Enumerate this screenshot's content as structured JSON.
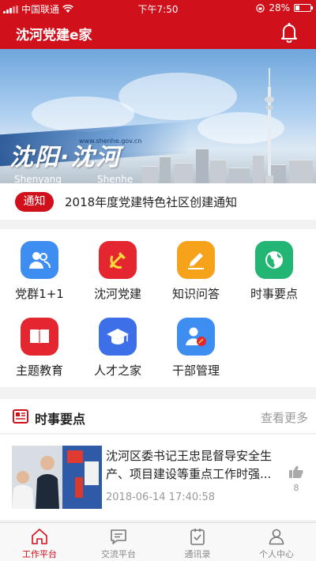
{
  "status_bar": {
    "carrier": "中国联通",
    "time": "下午7:50",
    "battery": "28%",
    "battery_level": 0.28
  },
  "header": {
    "title": "沈河党建e家"
  },
  "banner": {
    "big_text": "沈阳·沈河",
    "sub_left": "Shenyang",
    "sub_right": "Shenhe",
    "url": "www.shenhe.gov.cn",
    "page_count": 2,
    "active_page": 1
  },
  "notice": {
    "tag": "通知",
    "text": "2018年度党建特色社区创建通知"
  },
  "grid": {
    "items": [
      {
        "label": "党群1+1",
        "icon": "people-icon",
        "color": "#3d8ef0"
      },
      {
        "label": "沈河党建",
        "icon": "party-emblem-icon",
        "color": "#e3262f"
      },
      {
        "label": "知识问答",
        "icon": "pencil-icon",
        "color": "#f6a21a"
      },
      {
        "label": "时事要点",
        "icon": "globe-icon",
        "color": "#22b573"
      },
      {
        "label": "主题教育",
        "icon": "book-icon",
        "color": "#e3262f"
      },
      {
        "label": "人才之家",
        "icon": "graduation-cap-icon",
        "color": "#3d6fe8"
      },
      {
        "label": "干部管理",
        "icon": "user-badge-icon",
        "color": "#3d8ef0"
      }
    ]
  },
  "news_section": {
    "title": "时事要点",
    "more": "查看更多"
  },
  "news": [
    {
      "headline": "沈河区委书记王忠昆督导安全生产、项目建设等重点工作时强...",
      "date": "2018-06-14 17:40:58",
      "likes": "8"
    }
  ],
  "tabbar": {
    "tabs": [
      {
        "label": "工作平台",
        "icon": "home-icon",
        "active": true
      },
      {
        "label": "交流平台",
        "icon": "chat-icon",
        "active": false
      },
      {
        "label": "通讯录",
        "icon": "contacts-icon",
        "active": false
      },
      {
        "label": "个人中心",
        "icon": "person-icon",
        "active": false
      }
    ]
  },
  "colors": {
    "primary": "#d0111b",
    "muted": "#999999"
  }
}
